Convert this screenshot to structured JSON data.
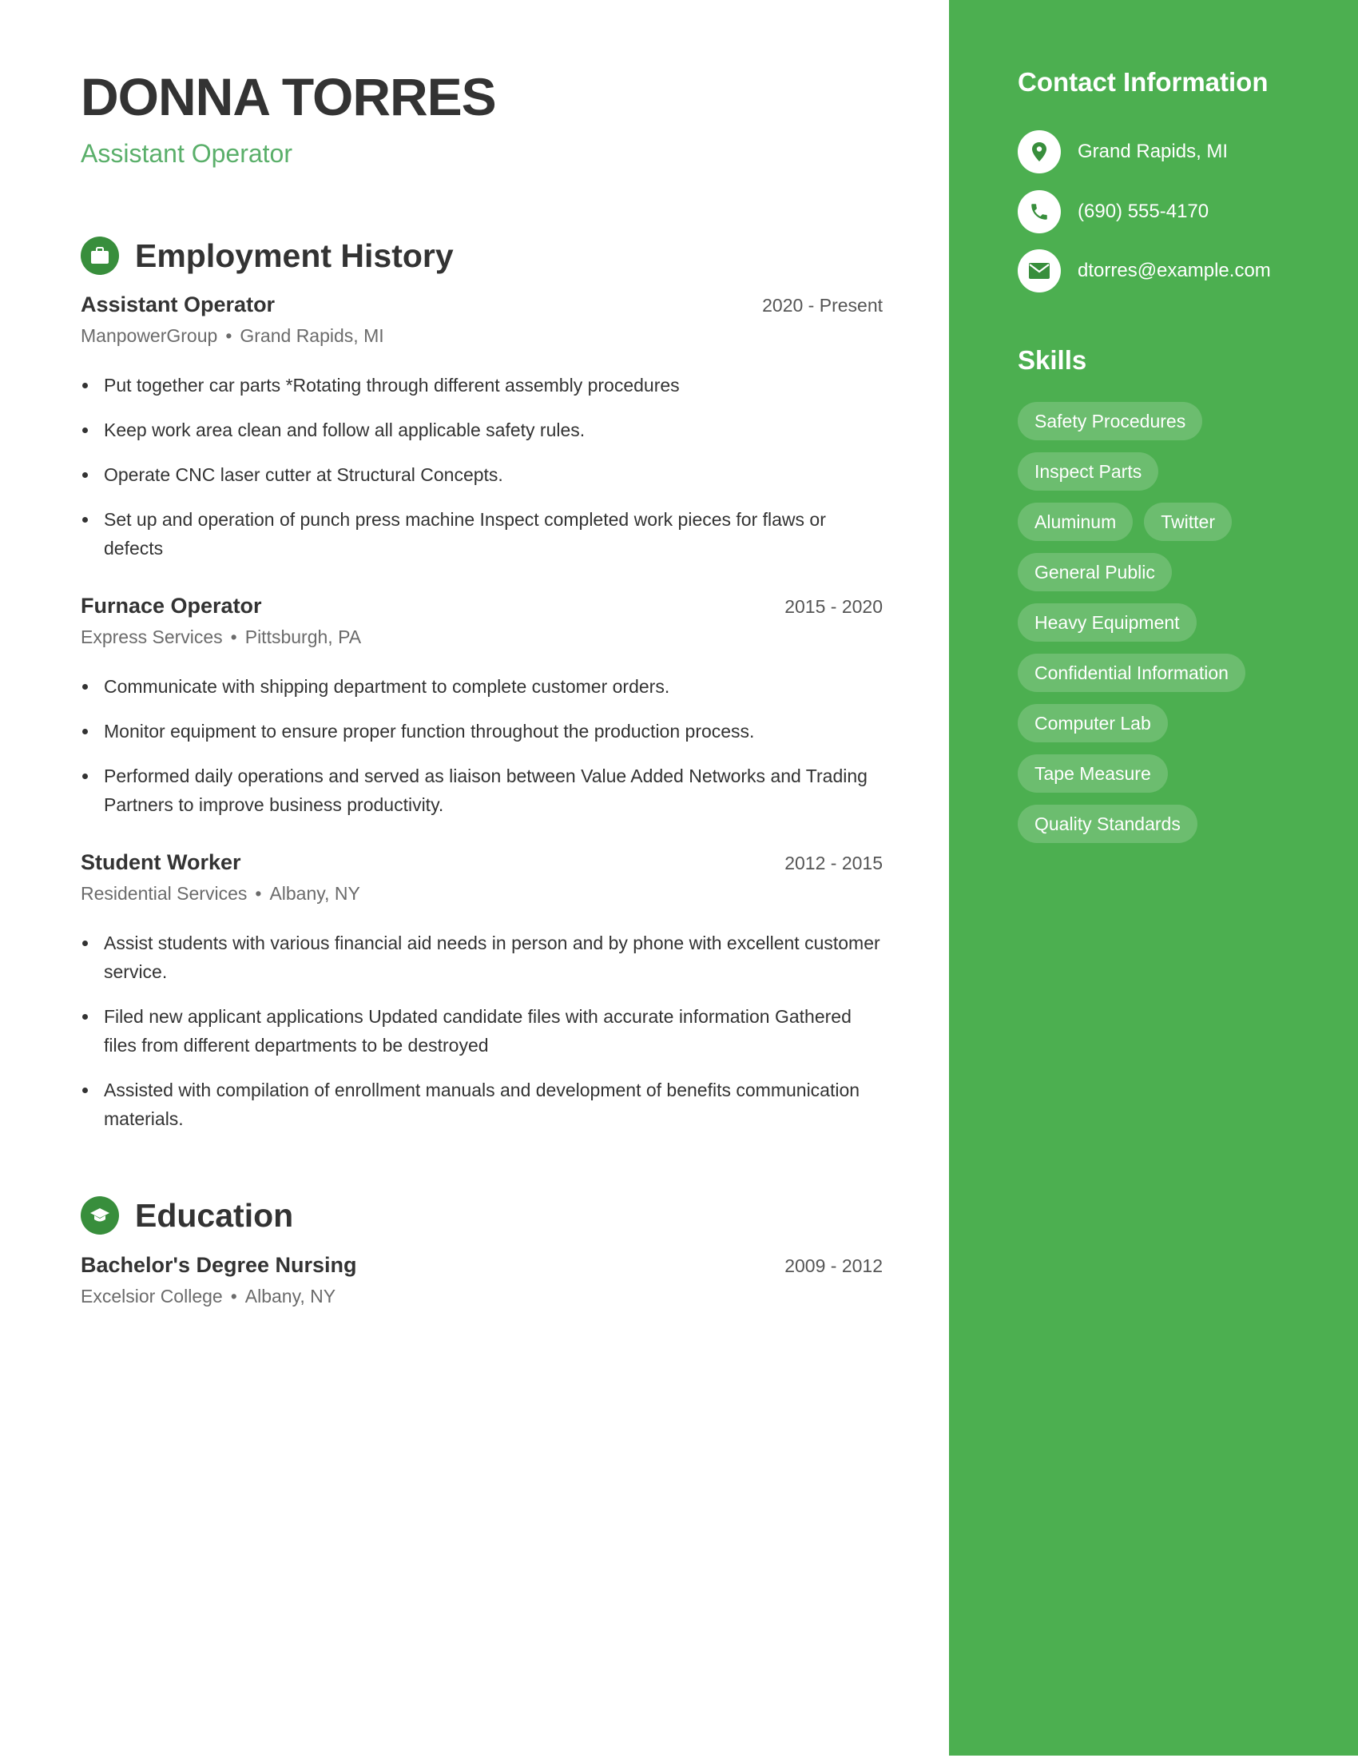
{
  "header": {
    "name": "DONNA TORRES",
    "job_title": "Assistant Operator"
  },
  "colors": {
    "accent": "#4caf50",
    "icon_bg": "#388e3c",
    "subtitle": "#5aaf6a"
  },
  "employment": {
    "title": "Employment History",
    "icon": "briefcase-icon",
    "jobs": [
      {
        "title": "Assistant Operator",
        "dates": "2020 - Present",
        "company": "ManpowerGroup",
        "location": "Grand Rapids, MI",
        "bullets": [
          "Put together car parts *Rotating through different assembly procedures",
          "Keep work area clean and follow all applicable safety rules.",
          "Operate CNC laser cutter at Structural Concepts.",
          "Set up and operation of punch press machine Inspect completed work pieces for flaws or defects"
        ]
      },
      {
        "title": "Furnace Operator",
        "dates": "2015 - 2020",
        "company": "Express Services",
        "location": "Pittsburgh, PA",
        "bullets": [
          "Communicate with shipping department to complete customer orders.",
          "Monitor equipment to ensure proper function throughout the production process.",
          "Performed daily operations and served as liaison between Value Added Networks and Trading Partners to improve business productivity."
        ]
      },
      {
        "title": "Student Worker",
        "dates": "2012 - 2015",
        "company": "Residential Services",
        "location": "Albany, NY",
        "bullets": [
          "Assist students with various financial aid needs in person and by phone with excellent customer service.",
          "Filed new applicant applications Updated candidate files with accurate information Gathered files from different departments to be destroyed",
          "Assisted with compilation of enrollment manuals and development of benefits communication materials."
        ]
      }
    ]
  },
  "education": {
    "title": "Education",
    "icon": "graduation-cap-icon",
    "entries": [
      {
        "title": "Bachelor's Degree Nursing",
        "dates": "2009 - 2012",
        "school": "Excelsior College",
        "location": "Albany, NY"
      }
    ]
  },
  "sidebar": {
    "contact_title": "Contact Information",
    "contacts": [
      {
        "icon": "location-pin-icon",
        "text": "Grand Rapids, MI"
      },
      {
        "icon": "phone-icon",
        "text": "(690) 555-4170"
      },
      {
        "icon": "email-icon",
        "text": "dtorres@example.com"
      }
    ],
    "skills_title": "Skills",
    "skills": [
      "Safety Procedures",
      "Inspect Parts",
      "Aluminum",
      "Twitter",
      "General Public",
      "Heavy Equipment",
      "Confidential Information",
      "Computer Lab",
      "Tape Measure",
      "Quality Standards"
    ]
  },
  "separator": "•"
}
